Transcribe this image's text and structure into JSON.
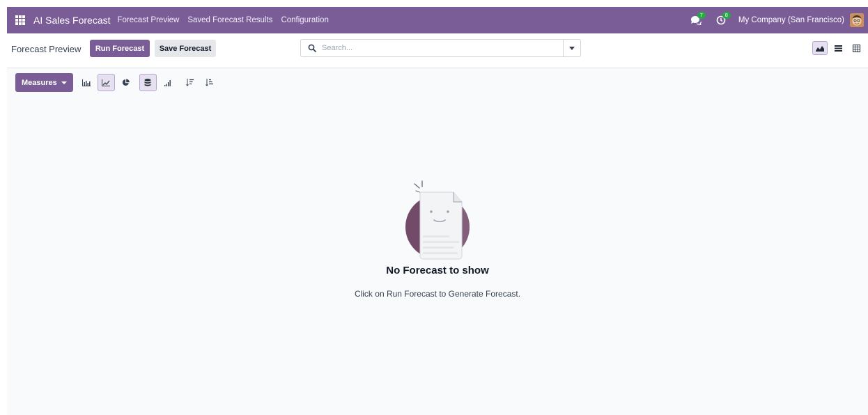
{
  "topbar": {
    "app_title": "AI Sales Forecast",
    "menu": [
      {
        "label": "Forecast Preview"
      },
      {
        "label": "Saved Forecast Results"
      },
      {
        "label": "Configuration"
      }
    ],
    "messages_count": "7",
    "activities_count": "8",
    "company": "My Company (San Francisco)"
  },
  "controlbar": {
    "breadcrumb": "Forecast Preview",
    "run_label": "Run Forecast",
    "save_label": "Save Forecast",
    "search_placeholder": "Search..."
  },
  "graphbar": {
    "measures_label": "Measures"
  },
  "empty_state": {
    "title": "No Forecast to show",
    "subtitle": "Click on Run Forecast to Generate Forecast."
  },
  "colors": {
    "navbar": "#7a5d96",
    "primary": "#7a5d96",
    "badge": "#28a745",
    "background": "#f9fafb"
  },
  "icons": [
    "apps-grid-icon",
    "chat-icon",
    "clock-icon",
    "avatar",
    "search-icon",
    "chevron-down-icon",
    "graph-view-icon",
    "list-view-icon",
    "pivot-view-icon",
    "bar-chart-icon",
    "line-chart-icon",
    "pie-chart-icon",
    "stacked-icon",
    "cumulative-icon",
    "sort-descending-icon",
    "sort-ascending-icon"
  ]
}
